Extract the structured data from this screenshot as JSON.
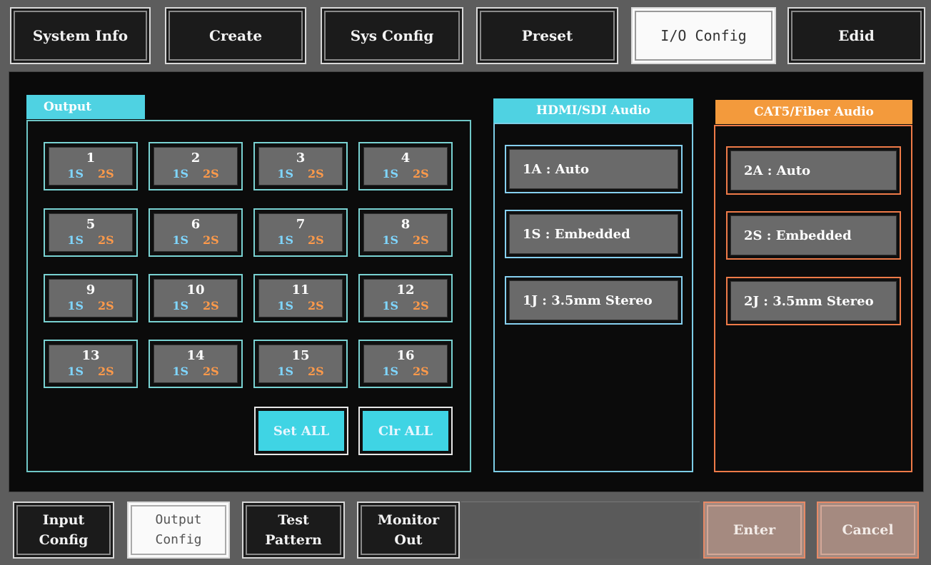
{
  "top_tabs": [
    {
      "label": "System Info"
    },
    {
      "label": "Create"
    },
    {
      "label": "Sys Config"
    },
    {
      "label": "Preset"
    },
    {
      "label": "I/O Config"
    },
    {
      "label": "Edid"
    }
  ],
  "output_panel": {
    "title": "Output",
    "outputs": [
      {
        "num": "1",
        "a": "1S",
        "b": "2S"
      },
      {
        "num": "2",
        "a": "1S",
        "b": "2S"
      },
      {
        "num": "3",
        "a": "1S",
        "b": "2S"
      },
      {
        "num": "4",
        "a": "1S",
        "b": "2S"
      },
      {
        "num": "5",
        "a": "1S",
        "b": "2S"
      },
      {
        "num": "6",
        "a": "1S",
        "b": "2S"
      },
      {
        "num": "7",
        "a": "1S",
        "b": "2S"
      },
      {
        "num": "8",
        "a": "1S",
        "b": "2S"
      },
      {
        "num": "9",
        "a": "1S",
        "b": "2S"
      },
      {
        "num": "10",
        "a": "1S",
        "b": "2S"
      },
      {
        "num": "11",
        "a": "1S",
        "b": "2S"
      },
      {
        "num": "12",
        "a": "1S",
        "b": "2S"
      },
      {
        "num": "13",
        "a": "1S",
        "b": "2S"
      },
      {
        "num": "14",
        "a": "1S",
        "b": "2S"
      },
      {
        "num": "15",
        "a": "1S",
        "b": "2S"
      },
      {
        "num": "16",
        "a": "1S",
        "b": "2S"
      }
    ],
    "set_all_label": "Set ALL",
    "clr_all_label": "Clr ALL"
  },
  "hdmi_panel": {
    "title": "HDMI/SDI Audio",
    "items": [
      "1A : Auto",
      "1S : Embedded",
      "1J : 3.5mm Stereo"
    ]
  },
  "cat_panel": {
    "title": "CAT5/Fiber Audio",
    "items": [
      "2A : Auto",
      "2S : Embedded",
      "2J : 3.5mm Stereo"
    ]
  },
  "bottom_buttons": [
    {
      "line1": "Input",
      "line2": "Config"
    },
    {
      "line1": "Output",
      "line2": "Config"
    },
    {
      "line1": "Test",
      "line2": "Pattern"
    },
    {
      "line1": "Monitor",
      "line2": "Out"
    }
  ],
  "enter_label": "Enter",
  "cancel_label": "Cancel",
  "colors": {
    "cyan_accent": "#4fd2e2",
    "orange_accent": "#f39a3c",
    "port_1s": "#7fd6ff",
    "port_2s": "#ff9a4a"
  }
}
